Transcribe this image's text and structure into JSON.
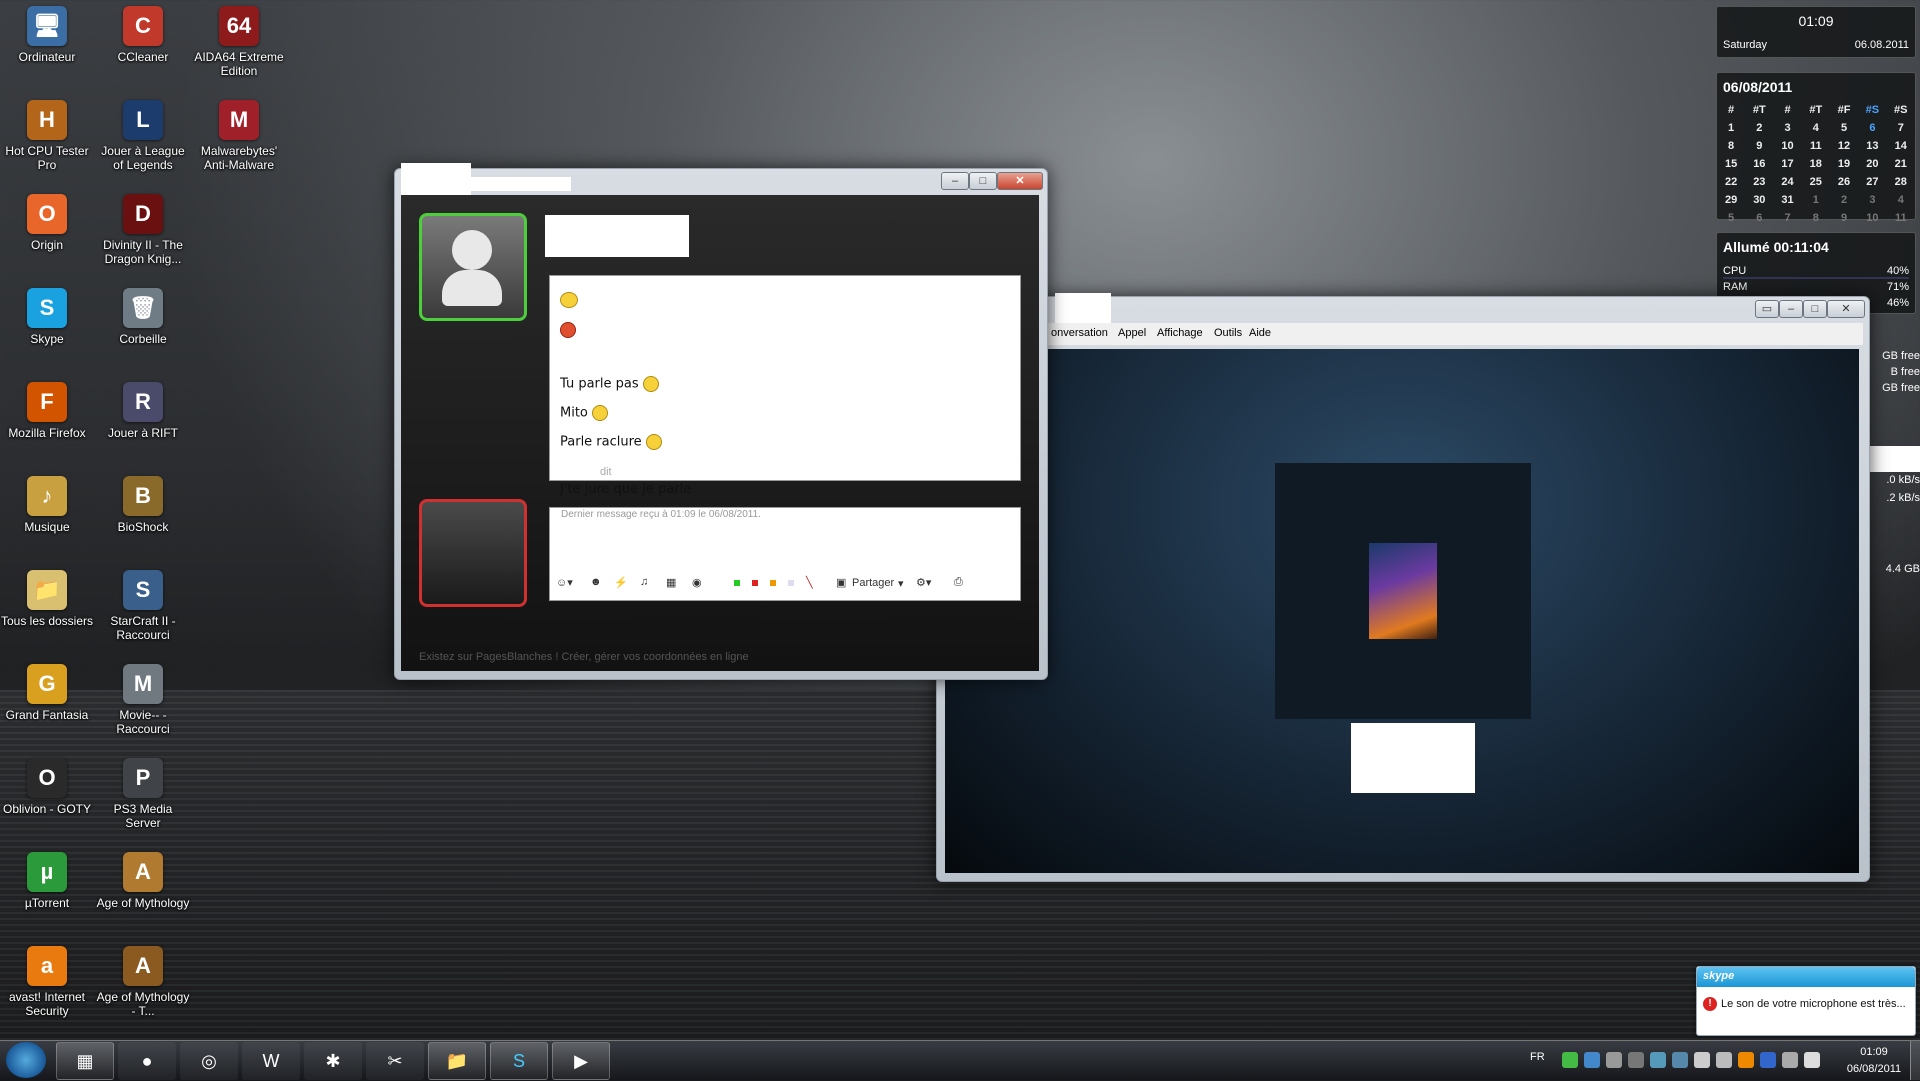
{
  "desktop": {
    "icons": [
      {
        "label": "Ordinateur",
        "glyph": "🖥",
        "color": "#3a6ea5"
      },
      {
        "label": "CCleaner",
        "glyph": "C",
        "color": "#c0392b"
      },
      {
        "label": "AIDA64 Extreme Edition",
        "glyph": "64",
        "color": "#8e1b1b"
      },
      {
        "label": "Hot CPU Tester Pro",
        "glyph": "H",
        "color": "#b3661a"
      },
      {
        "label": "Jouer à League of Legends",
        "glyph": "L",
        "color": "#1d3c6e"
      },
      {
        "label": "Malwarebytes' Anti-Malware",
        "glyph": "M",
        "color": "#a0202a"
      },
      {
        "label": "Origin",
        "glyph": "O",
        "color": "#e8662a"
      },
      {
        "label": "Divinity II - The Dragon Knig...",
        "glyph": "D",
        "color": "#6b1010"
      },
      {
        "label": "Skype",
        "glyph": "S",
        "color": "#1aa2e0"
      },
      {
        "label": "Corbeille",
        "glyph": "🗑",
        "color": "#6f7c86"
      },
      {
        "label": "Mozilla Firefox",
        "glyph": "F",
        "color": "#d35400"
      },
      {
        "label": "Jouer à RIFT",
        "glyph": "R",
        "color": "#4a4a6a"
      },
      {
        "label": "Musique",
        "glyph": "♪",
        "color": "#c8a040"
      },
      {
        "label": "BioShock",
        "glyph": "B",
        "color": "#8a6a2a"
      },
      {
        "label": "Tous les dossiers",
        "glyph": "📁",
        "color": "#d9c070"
      },
      {
        "label": "StarCraft II - Raccourci",
        "glyph": "S",
        "color": "#3a5f8a"
      },
      {
        "label": "Grand Fantasia",
        "glyph": "G",
        "color": "#d9a020"
      },
      {
        "label": "Movie-- - Raccourci",
        "glyph": "M",
        "color": "#707880"
      },
      {
        "label": "Oblivion - GOTY",
        "glyph": "O",
        "color": "#2a2a2a"
      },
      {
        "label": "PS3 Media Server",
        "glyph": "P",
        "color": "#404448"
      },
      {
        "label": "µTorrent",
        "glyph": "µ",
        "color": "#2a9a3a"
      },
      {
        "label": "Age of Mythology",
        "glyph": "A",
        "color": "#b07a30"
      },
      {
        "label": "avast! Internet Security",
        "glyph": "a",
        "color": "#e87a10"
      },
      {
        "label": "Age of Mythology - T...",
        "glyph": "A",
        "color": "#8a5a20"
      }
    ]
  },
  "clock_gadget": {
    "time": "01:09",
    "day": "Saturday",
    "date": "06.08.2011"
  },
  "calendar_gadget": {
    "title": "06/08/2011",
    "headers": [
      "#",
      "#T",
      "#",
      "#T",
      "#F",
      "#S",
      "#S"
    ],
    "rows": [
      [
        "1",
        "2",
        "3",
        "4",
        "5",
        "6",
        "7"
      ],
      [
        "8",
        "9",
        "10",
        "11",
        "12",
        "13",
        "14"
      ],
      [
        "15",
        "16",
        "17",
        "18",
        "19",
        "20",
        "21"
      ],
      [
        "22",
        "23",
        "24",
        "25",
        "26",
        "27",
        "28"
      ],
      [
        "29",
        "30",
        "31",
        "1",
        "2",
        "3",
        "4"
      ],
      [
        "5",
        "6",
        "7",
        "8",
        "9",
        "10",
        "11"
      ]
    ],
    "highlight_color": "#4aa3ff"
  },
  "sysmon_gadget": {
    "uptime": "Allumé 00:11:04",
    "cpu_label": "CPU",
    "cpu_value": "40%",
    "ram_label": "RAM",
    "ram_value": "71%",
    "third_value": "46%"
  },
  "side_gadget": {
    "d1": "GB free",
    "d2": "B free",
    "d3": "GB free",
    "n1": ".0 kB/s",
    "n2": ".2 kB/s",
    "disk": "4.4 GB"
  },
  "chat_window": {
    "messages": [
      {
        "text": "Tu parle pas",
        "smiley": true
      },
      {
        "text": "Mito",
        "smiley": true
      },
      {
        "text": "Parle raclure",
        "smiley": true
      }
    ],
    "says_label": "dit",
    "last_message": "J'te jure que je parle",
    "status_line": "Dernier message reçu à 01:09 le 06/08/2011.",
    "share_label": "Partager",
    "ad_text": "Existez sur PagesBlanches ! Créer, gérer vos coordonnées en ligne",
    "input_value": ""
  },
  "skype_window": {
    "menu": [
      "onversation",
      "Appel",
      "Affichage",
      "Outils",
      "Aide"
    ]
  },
  "skype_notification": {
    "brand": "skype",
    "message": "Le son de votre microphone est très..."
  },
  "taskbar": {
    "lang": "FR",
    "time": "01:09",
    "date": "06/08/2011"
  }
}
